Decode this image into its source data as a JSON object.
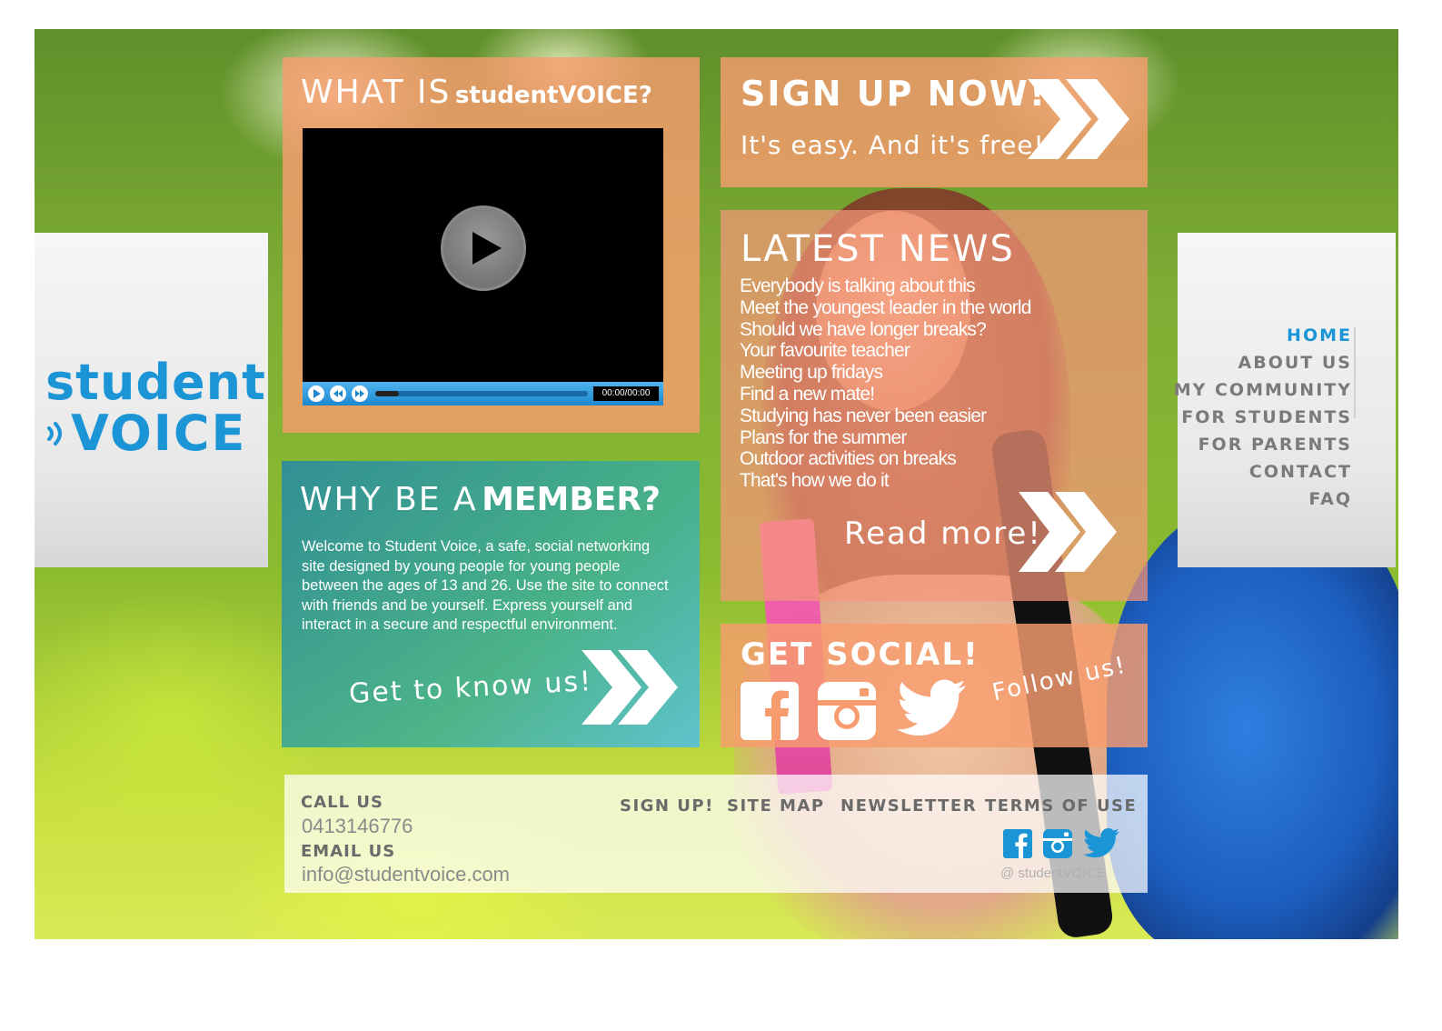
{
  "brand": {
    "line1": "student",
    "line2": "VOICE",
    "color": "#1c95d6"
  },
  "nav": {
    "items": [
      {
        "label": "HOME",
        "active": true
      },
      {
        "label": "ABOUT US",
        "active": false
      },
      {
        "label": "MY COMMUNITY",
        "active": false
      },
      {
        "label": "FOR STUDENTS",
        "active": false
      },
      {
        "label": "FOR PARENTS",
        "active": false
      },
      {
        "label": "CONTACT",
        "active": false
      },
      {
        "label": "FAQ",
        "active": false
      }
    ]
  },
  "what_is": {
    "heading_prefix": "WHAT IS",
    "heading_brand": "studentVOICE?",
    "video": {
      "time": "00:00/00:00"
    }
  },
  "why_member": {
    "heading_prefix": "WHY BE A",
    "heading_strong": "MEMBER?",
    "body": "Welcome to Student Voice, a safe, social networking site designed by young people for young people between the ages of 13 and 26. Use the site to connect with friends and be yourself.  Express yourself and interact in a secure and respectful environment.",
    "cta": "Get to know us!"
  },
  "signup": {
    "heading": "SIGN UP NOW!",
    "sub": "It's easy. And it's free!"
  },
  "news": {
    "heading": "LATEST NEWS",
    "items": [
      "Everybody is talking about this",
      "Meet the youngest leader in the world",
      "Should we have longer breaks?",
      "Your favourite teacher",
      "Meeting up fridays",
      "Find a new mate!",
      "Studying has never been easier",
      "Plans for the summer",
      "Outdoor activities on breaks",
      "That's how we do it"
    ],
    "cta": "Read more!"
  },
  "social": {
    "heading": "GET SOCIAL!",
    "follow": "Follow us!",
    "icons": [
      "facebook-icon",
      "instagram-icon",
      "twitter-icon"
    ]
  },
  "footer": {
    "call_label": "CALL US",
    "phone": "0413146776",
    "email_label": "EMAIL US",
    "email": "info@studentvoice.com",
    "links": [
      "SIGN UP!",
      "SITE MAP",
      "NEWSLETTER",
      "TERMS OF USE"
    ],
    "handle": "@ studentVOICE",
    "icon_color": "#1c95d6"
  }
}
